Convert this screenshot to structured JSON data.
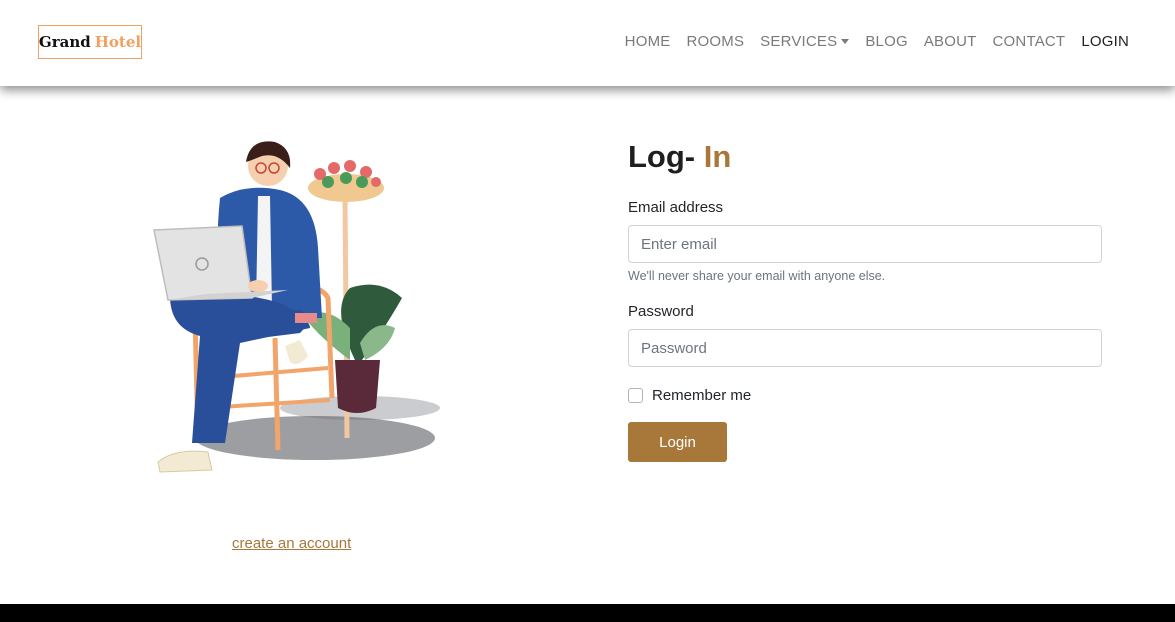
{
  "brand": {
    "part1": "Grand",
    "part2": "Hotel"
  },
  "nav": {
    "home": "HOME",
    "rooms": "ROOMS",
    "services": "SERVICES",
    "blog": "BLOG",
    "about": "ABOUT",
    "contact": "CONTACT",
    "login": "LOGIN"
  },
  "form": {
    "title_part1": "Log-",
    "title_part2": "In",
    "email_label": "Email address",
    "email_placeholder": "Enter email",
    "email_help": "We'll never share your email with anyone else.",
    "password_label": "Password",
    "password_placeholder": "Password",
    "remember_label": "Remember me",
    "submit_label": "Login"
  },
  "links": {
    "create_account": "create an account"
  },
  "colors": {
    "accent": "#a8773a",
    "brand_accent": "#f0a060",
    "footer": "#000000"
  }
}
